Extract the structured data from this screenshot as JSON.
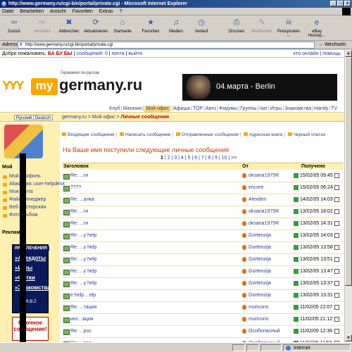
{
  "window": {
    "title": "http://www.germany.ru/cgi-bin/portal/private.cgi - Microsoft Internet Explorer",
    "controls": [
      "_",
      "□",
      "x"
    ]
  },
  "menu": [
    "Datei",
    "Bearbeiten",
    "Ansicht",
    "Favoriten",
    "Extras",
    "?"
  ],
  "toolbar": [
    {
      "label": "Zurück",
      "icon": "back-arrow-icon",
      "glyph": "⇦",
      "enabled": true
    },
    {
      "label": "Vorwärts",
      "icon": "forward-arrow-icon",
      "glyph": "⇨",
      "enabled": false
    },
    {
      "label": "Abbrechen",
      "icon": "stop-icon",
      "glyph": "✖",
      "enabled": true
    },
    {
      "label": "Aktualisieren",
      "icon": "refresh-icon",
      "glyph": "⟳",
      "enabled": true
    },
    {
      "label": "Startseite",
      "icon": "home-icon",
      "glyph": "⌂",
      "enabled": true
    },
    {
      "label": "Favoriten",
      "icon": "favorites-icon",
      "glyph": "★",
      "enabled": true
    },
    {
      "label": "Medien",
      "icon": "media-icon",
      "glyph": "♫",
      "enabled": true
    },
    {
      "label": "Verlauf",
      "icon": "history-icon",
      "glyph": "◷",
      "enabled": true
    },
    {
      "label": "Drucken",
      "icon": "print-icon",
      "glyph": "⎙",
      "enabled": true
    },
    {
      "label": "Bearbeiten",
      "icon": "edit-icon",
      "glyph": "✎",
      "enabled": false
    },
    {
      "label": "Preispiraten ...",
      "icon": "pirate-icon",
      "glyph": "☠",
      "enabled": true
    },
    {
      "label": "eBay Homep...",
      "icon": "ebay-icon",
      "glyph": "e",
      "enabled": true
    }
  ],
  "address": {
    "label": "Adresse",
    "url": "http://www.germany.ru/cgi-bin/portal/private.cgi",
    "go": "Wechseln zu"
  },
  "site": {
    "welcome": "Добро пожаловать,",
    "username": "БА БУ БЫ",
    "messages_link": "сообщений: 0",
    "mail_link": "почта",
    "logout_link": "выйти",
    "online_link": "кто онлайн",
    "help_link": "помощь",
    "logo_my": "my",
    "logo_name": "germany.ru",
    "logo_tagline": "Германия по-русски",
    "banner_text": "04.марта - Berlin",
    "nav": [
      "Клуб",
      "Магазин",
      "Мой офис",
      "Афиша",
      "TOP",
      "Авто",
      "Форумы",
      "Группы",
      "Чат",
      "Игры",
      "Знакомства",
      "Handy",
      "TV"
    ],
    "nav_active": "Мой офис",
    "lang": [
      "Русский",
      "Deutsch"
    ],
    "breadcrumb": [
      "germany.ru",
      "Мой офис",
      "Личные сообщения"
    ]
  },
  "sidebar": {
    "section": "Мой",
    "items": [
      "Мой профиль",
      "Alias-Имя: user-helpdesk",
      "Моя почта",
      "Файл-менеджер",
      "Веб-мастерская",
      "Фотоальбом"
    ],
    "ads_title": "Реклама",
    "ad_heading": "РАЗВЛЕЧЕНИЯ",
    "ad_links": [
      "»Анекдоты",
      "»Игры",
      "»Фотки",
      "»Знакомства"
    ],
    "ad_footer": "R:B:Z",
    "ad2_text": "Срочное сообщение!"
  },
  "messages": {
    "folders": [
      "Входящие сообщения",
      "Написать сообщение",
      "Отправленные сообщения",
      "Адресная книга",
      "Черный список"
    ],
    "heading": "На Ваше имя поступили следующие личные сообщения",
    "pages": [
      "1",
      "2",
      "3",
      "4",
      "5",
      "6",
      "7",
      "8",
      "9",
      "10",
      ">>"
    ],
    "current_page": "1",
    "columns": [
      "Заголовок",
      "От",
      "Получено"
    ],
    "rows": [
      {
        "subject": "Re: ...ги",
        "from": "oksana1975R",
        "date": "15/02/05 09:45"
      },
      {
        "subject": "????",
        "from": "encore",
        "date": "15/02/05 06:24"
      },
      {
        "subject": "Re: ...алка",
        "from": "Alexden",
        "date": "14/02/05 14:03"
      },
      {
        "subject": "Re: ...ги",
        "from": "oksana1975R",
        "date": "13/02/05 18:02"
      },
      {
        "subject": "Re: ...ги",
        "from": "oksana1975R",
        "date": "13/02/05 14:31"
      },
      {
        "subject": "Re: ...y help",
        "from": "Gortenzija",
        "date": "13/02/05 14:03"
      },
      {
        "subject": "Re: ...y help",
        "from": "Gortenzija",
        "date": "13/02/05 13:58"
      },
      {
        "subject": "Re: ...y help",
        "from": "Gortenzija",
        "date": "13/02/05 13:51"
      },
      {
        "subject": "Re: ...y help",
        "from": "Gortenzija",
        "date": "13/02/05 13:47"
      },
      {
        "subject": "Re: ...y help",
        "from": "Gortenzija",
        "date": "13/02/05 13:37"
      },
      {
        "subject": "e help ...elp",
        "from": "Gortenzija",
        "date": "13/02/05 13:31"
      },
      {
        "subject": "Re: ...тация",
        "from": "moricons",
        "date": "11/02/05 22:07"
      },
      {
        "subject": "инс...ация",
        "from": "moricons",
        "date": "11/02/05 21:12"
      },
      {
        "subject": "Re: ...рос",
        "from": "Особопасный",
        "date": "11/02/05 12:36"
      },
      {
        "subject": "Re: ...рос",
        "from": "Особопасный",
        "date": "11/02/05 11:56"
      }
    ]
  },
  "status": {
    "zone": "Internet"
  }
}
